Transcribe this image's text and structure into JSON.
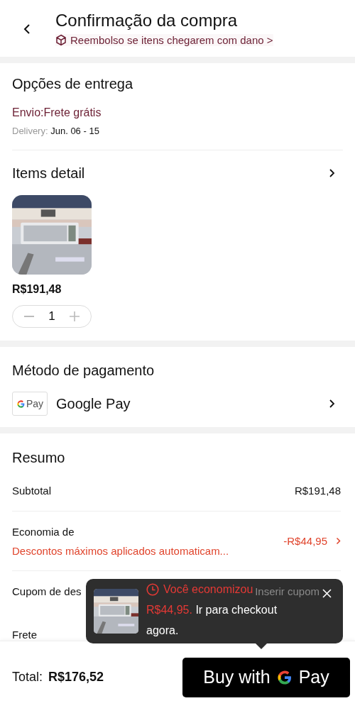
{
  "header": {
    "title": "Confirmação da compra",
    "subtitle": "Reembolso se itens chegarem com dano >"
  },
  "delivery": {
    "heading": "Opções de entrega",
    "shipping": "Envio:Frete grátis",
    "date_label": "Delivery:",
    "date": "Jun. 06 - 15"
  },
  "items": {
    "heading": "Items detail",
    "products": [
      {
        "kind": "picture",
        "price": "R$191,48",
        "quantity": "1"
      }
    ]
  },
  "payment": {
    "heading": "Método de pagamento",
    "method": "Google Pay",
    "logo": "Pay"
  },
  "summary": {
    "heading": "Resumo",
    "rows": [
      {
        "kind": "plain",
        "label": "Subtotal",
        "value": "R$191,48"
      },
      {
        "kind": "discount",
        "label": "Economia de",
        "note": "Descontos máximos aplicados automaticam...",
        "value": "-R$44,95"
      },
      {
        "kind": "link",
        "label": "Cupom de des",
        "value": "Inserir cupom"
      },
      {
        "kind": "label",
        "label": "Frete"
      }
    ]
  },
  "footer": {
    "total_label": "Total:",
    "total": "R$176,52",
    "pay_button": {
      "text": "Buy with",
      "brand": "Pay"
    }
  },
  "toast": {
    "title": "Você economizou",
    "amount": "R$44,95.",
    "message": "Ir para checkout agora."
  }
}
